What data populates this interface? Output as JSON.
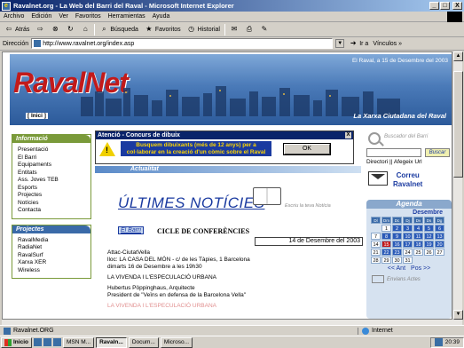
{
  "window": {
    "title": "Ravalnet.org - La Web del Barri del Raval - Microsoft Internet Explorer",
    "min": "_",
    "max": "□",
    "close": "X"
  },
  "menu": [
    "Archivo",
    "Edición",
    "Ver",
    "Favoritos",
    "Herramientas",
    "Ayuda"
  ],
  "toolbar": {
    "back": "Atrás",
    "search": "Búsqueda",
    "favorites": "Favoritos",
    "history": "Historial"
  },
  "address": {
    "label": "Dirección",
    "url": "http://www.ravalnet.org/index.asp",
    "go": "Ir a",
    "links": "Vínculos »"
  },
  "header": {
    "logo_a": "Raval",
    "logo_b": "Net",
    "date": "El Raval, a 15 de Desembre del 2003",
    "tagline": "La Xarxa Ciutadana del Raval",
    "inici": "[ Inici ]"
  },
  "nav_informacio": {
    "title": "Informació",
    "items": [
      "Presentació",
      "El Barri",
      "Equipaments",
      "Entitats",
      "Ass. Joves TEB",
      "Esports",
      "Projectes",
      "Notícies",
      "Contacta"
    ]
  },
  "nav_projectes": {
    "title": "Projectes",
    "items": [
      "RavalMedia",
      "RadiaNet",
      "RavalSurf",
      "Xarxa XER",
      "Wireless"
    ]
  },
  "popup": {
    "title": "Atenció - Concurs de dibuix",
    "message": "Busquem dibuixants (més de 12 anys) per a col·laborar en la creació d'un còmic sobre el Raval",
    "ok": "OK",
    "close": "X"
  },
  "main": {
    "section": "Actualitat",
    "title": "ÚLTIMES NOTÍCIES",
    "write_link": "Escriu la teva Notícia",
    "tag": "El Barri",
    "news_title": "CICLE DE CONFERÈNCIES",
    "news_date": "14 de Desembre del 2003",
    "body": [
      "Attac-CiutatVella",
      "lloc: LA CASA DEL MÓN - c/ de les Tàpies, 1 Barcelona",
      "dimarts 16 de Desembre a les 19h30",
      "LA VIVENDA I L'ESPECULACIÓ URBANA",
      "Hubertus Pöppinghaus, Arquitecte",
      "President de \"Veïns en defensa de la Barcelona Vella\"",
      "LA VIVENDA I L'ESPECULACIÓ URBANA"
    ]
  },
  "right": {
    "search_label": "Buscador del Barri",
    "search_btn": "Buscar",
    "dir_links": "Directori || Afegeix Url",
    "correu": "Correu",
    "correu2": "Ravalnet",
    "agenda": "Agenda",
    "month": "Desembre",
    "weekdays": [
      "Dl",
      "Dm",
      "Dc",
      "Dj",
      "Dv",
      "Ds",
      "Dg"
    ],
    "days": [
      "",
      "1",
      "2",
      "3",
      "4",
      "5",
      "6",
      "7",
      "8",
      "9",
      "10",
      "11",
      "12",
      "13",
      "14",
      "15",
      "16",
      "17",
      "18",
      "19",
      "20",
      "21",
      "22",
      "23",
      "24",
      "25",
      "26",
      "27",
      "28",
      "29",
      "30",
      "31"
    ],
    "prev": "<< Ant",
    "next": "Pos >>",
    "send": "Envians Actes"
  },
  "status": {
    "left": "Ravalnet.ORG",
    "zone": "Internet"
  },
  "taskbar": {
    "start": "Inicio",
    "tasks": [
      "MSN M...",
      "Ravaln...",
      "Docum...",
      "Microso..."
    ],
    "clock": "20:39"
  },
  "colors": {
    "accent_red": "#c21a1a",
    "nav_green": "#7a9a3a",
    "link_blue": "#1a3aa0"
  }
}
